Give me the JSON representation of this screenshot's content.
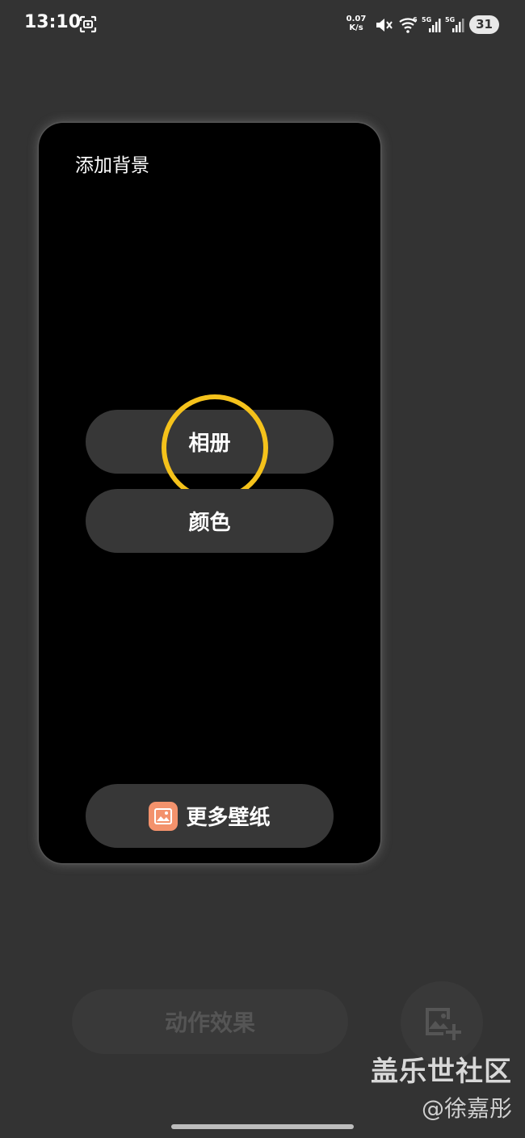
{
  "status_bar": {
    "time": "13:10",
    "net_speed_value": "0.07",
    "net_speed_unit": "K/s",
    "battery_level": "31",
    "icons": [
      "screenshot-icon",
      "mute-icon",
      "wifi-icon",
      "signal-5g-icon",
      "signal-5g-icon"
    ]
  },
  "card": {
    "title": "添加背景",
    "album_label": "相册",
    "color_label": "颜色",
    "more_wallpaper_label": "更多壁纸"
  },
  "bottom": {
    "effect_label": "动作效果"
  },
  "watermark": {
    "main": "盖乐世社区",
    "sub": "@徐嘉彤"
  },
  "colors": {
    "background": "#333333",
    "card": "#000000",
    "pill": "#373737",
    "highlight": "#f5c21b",
    "wallpaper_icon": "#f3926c"
  }
}
